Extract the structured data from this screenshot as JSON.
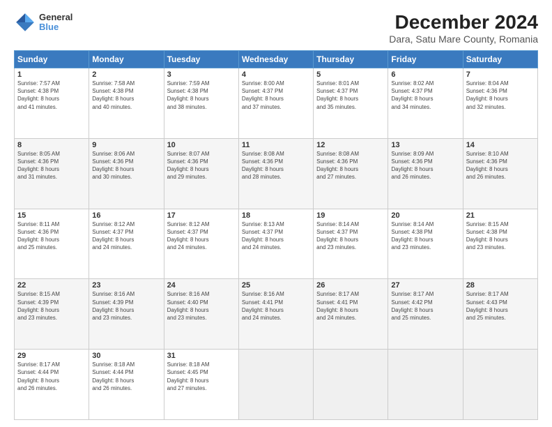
{
  "logo": {
    "line1": "General",
    "line2": "Blue"
  },
  "title": "December 2024",
  "subtitle": "Dara, Satu Mare County, Romania",
  "days_header": [
    "Sunday",
    "Monday",
    "Tuesday",
    "Wednesday",
    "Thursday",
    "Friday",
    "Saturday"
  ],
  "weeks": [
    [
      {
        "num": "1",
        "info": "Sunrise: 7:57 AM\nSunset: 4:38 PM\nDaylight: 8 hours\nand 41 minutes."
      },
      {
        "num": "2",
        "info": "Sunrise: 7:58 AM\nSunset: 4:38 PM\nDaylight: 8 hours\nand 40 minutes."
      },
      {
        "num": "3",
        "info": "Sunrise: 7:59 AM\nSunset: 4:38 PM\nDaylight: 8 hours\nand 38 minutes."
      },
      {
        "num": "4",
        "info": "Sunrise: 8:00 AM\nSunset: 4:37 PM\nDaylight: 8 hours\nand 37 minutes."
      },
      {
        "num": "5",
        "info": "Sunrise: 8:01 AM\nSunset: 4:37 PM\nDaylight: 8 hours\nand 35 minutes."
      },
      {
        "num": "6",
        "info": "Sunrise: 8:02 AM\nSunset: 4:37 PM\nDaylight: 8 hours\nand 34 minutes."
      },
      {
        "num": "7",
        "info": "Sunrise: 8:04 AM\nSunset: 4:36 PM\nDaylight: 8 hours\nand 32 minutes."
      }
    ],
    [
      {
        "num": "8",
        "info": "Sunrise: 8:05 AM\nSunset: 4:36 PM\nDaylight: 8 hours\nand 31 minutes."
      },
      {
        "num": "9",
        "info": "Sunrise: 8:06 AM\nSunset: 4:36 PM\nDaylight: 8 hours\nand 30 minutes."
      },
      {
        "num": "10",
        "info": "Sunrise: 8:07 AM\nSunset: 4:36 PM\nDaylight: 8 hours\nand 29 minutes."
      },
      {
        "num": "11",
        "info": "Sunrise: 8:08 AM\nSunset: 4:36 PM\nDaylight: 8 hours\nand 28 minutes."
      },
      {
        "num": "12",
        "info": "Sunrise: 8:08 AM\nSunset: 4:36 PM\nDaylight: 8 hours\nand 27 minutes."
      },
      {
        "num": "13",
        "info": "Sunrise: 8:09 AM\nSunset: 4:36 PM\nDaylight: 8 hours\nand 26 minutes."
      },
      {
        "num": "14",
        "info": "Sunrise: 8:10 AM\nSunset: 4:36 PM\nDaylight: 8 hours\nand 26 minutes."
      }
    ],
    [
      {
        "num": "15",
        "info": "Sunrise: 8:11 AM\nSunset: 4:36 PM\nDaylight: 8 hours\nand 25 minutes."
      },
      {
        "num": "16",
        "info": "Sunrise: 8:12 AM\nSunset: 4:37 PM\nDaylight: 8 hours\nand 24 minutes."
      },
      {
        "num": "17",
        "info": "Sunrise: 8:12 AM\nSunset: 4:37 PM\nDaylight: 8 hours\nand 24 minutes."
      },
      {
        "num": "18",
        "info": "Sunrise: 8:13 AM\nSunset: 4:37 PM\nDaylight: 8 hours\nand 24 minutes."
      },
      {
        "num": "19",
        "info": "Sunrise: 8:14 AM\nSunset: 4:37 PM\nDaylight: 8 hours\nand 23 minutes."
      },
      {
        "num": "20",
        "info": "Sunrise: 8:14 AM\nSunset: 4:38 PM\nDaylight: 8 hours\nand 23 minutes."
      },
      {
        "num": "21",
        "info": "Sunrise: 8:15 AM\nSunset: 4:38 PM\nDaylight: 8 hours\nand 23 minutes."
      }
    ],
    [
      {
        "num": "22",
        "info": "Sunrise: 8:15 AM\nSunset: 4:39 PM\nDaylight: 8 hours\nand 23 minutes."
      },
      {
        "num": "23",
        "info": "Sunrise: 8:16 AM\nSunset: 4:39 PM\nDaylight: 8 hours\nand 23 minutes."
      },
      {
        "num": "24",
        "info": "Sunrise: 8:16 AM\nSunset: 4:40 PM\nDaylight: 8 hours\nand 23 minutes."
      },
      {
        "num": "25",
        "info": "Sunrise: 8:16 AM\nSunset: 4:41 PM\nDaylight: 8 hours\nand 24 minutes."
      },
      {
        "num": "26",
        "info": "Sunrise: 8:17 AM\nSunset: 4:41 PM\nDaylight: 8 hours\nand 24 minutes."
      },
      {
        "num": "27",
        "info": "Sunrise: 8:17 AM\nSunset: 4:42 PM\nDaylight: 8 hours\nand 25 minutes."
      },
      {
        "num": "28",
        "info": "Sunrise: 8:17 AM\nSunset: 4:43 PM\nDaylight: 8 hours\nand 25 minutes."
      }
    ],
    [
      {
        "num": "29",
        "info": "Sunrise: 8:17 AM\nSunset: 4:44 PM\nDaylight: 8 hours\nand 26 minutes."
      },
      {
        "num": "30",
        "info": "Sunrise: 8:18 AM\nSunset: 4:44 PM\nDaylight: 8 hours\nand 26 minutes."
      },
      {
        "num": "31",
        "info": "Sunrise: 8:18 AM\nSunset: 4:45 PM\nDaylight: 8 hours\nand 27 minutes."
      },
      null,
      null,
      null,
      null
    ]
  ]
}
